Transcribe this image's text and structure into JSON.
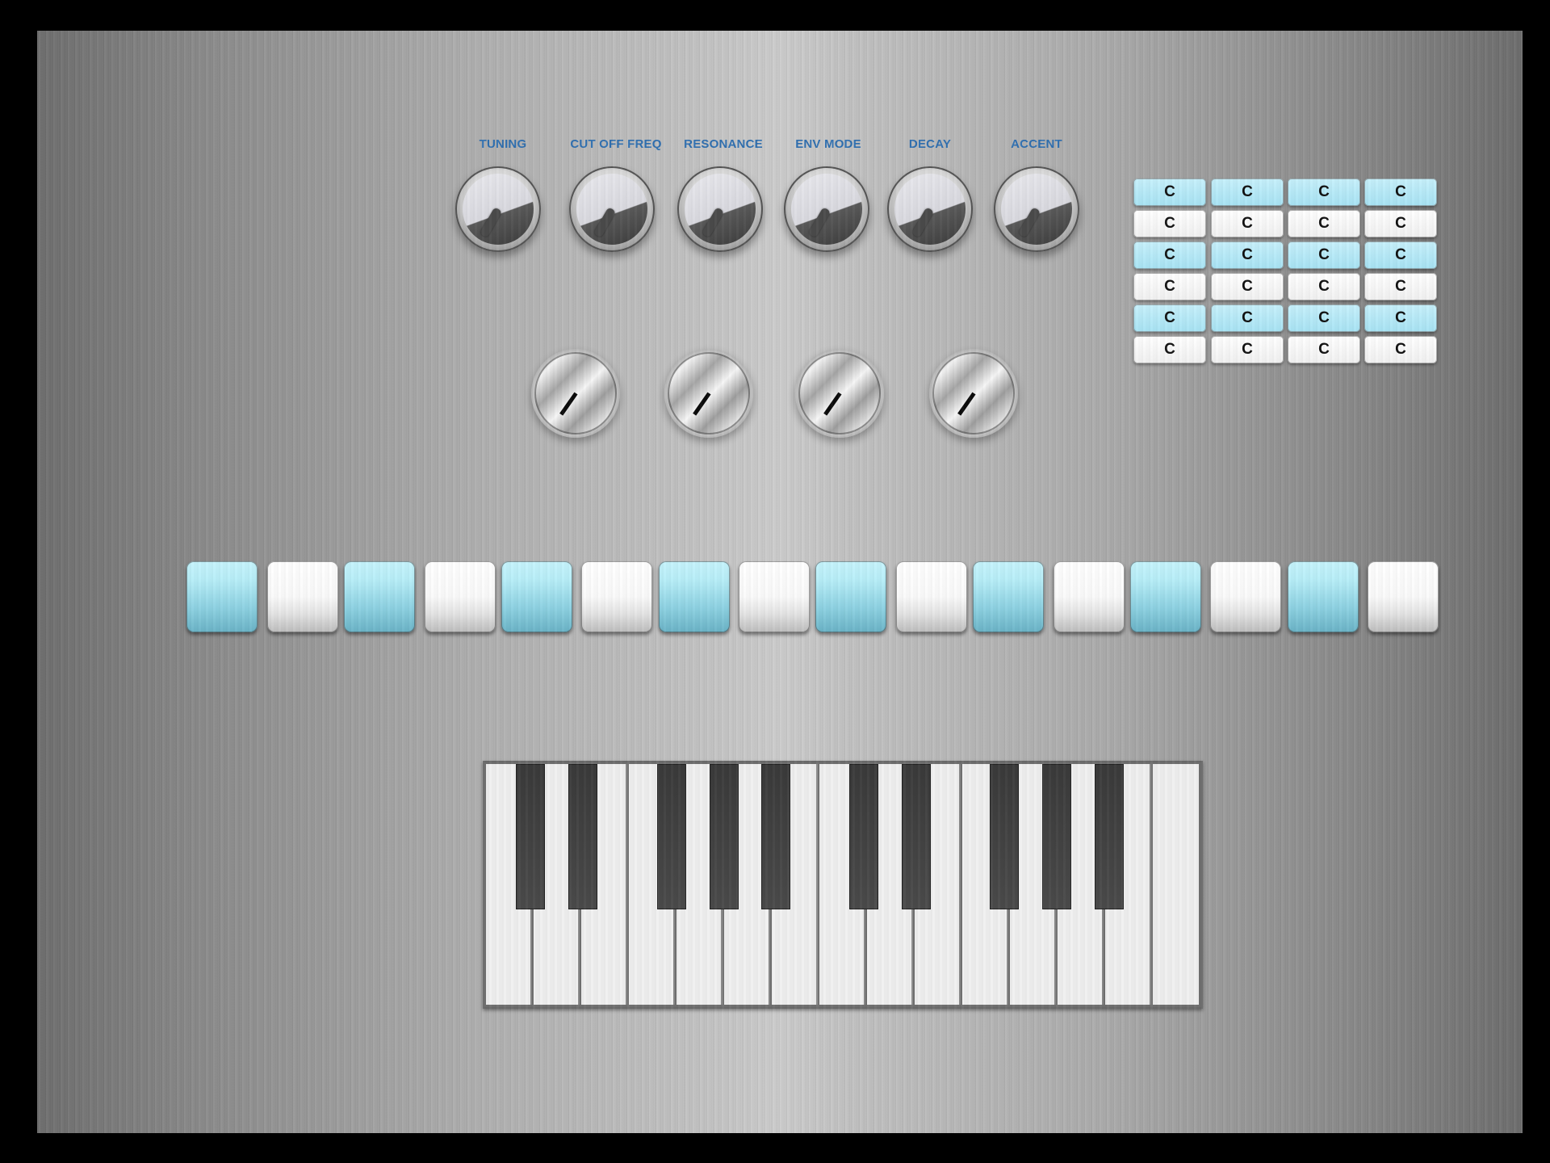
{
  "knobs": [
    {
      "label": "TUNING"
    },
    {
      "label": "CUT OFF FREQ"
    },
    {
      "label": "RESONANCE"
    },
    {
      "label": "ENV MODE"
    },
    {
      "label": "DECAY"
    },
    {
      "label": "ACCENT"
    }
  ],
  "note_grid": {
    "rows": [
      [
        "C",
        "C",
        "C",
        "C"
      ],
      [
        "C",
        "C",
        "C",
        "C"
      ],
      [
        "C",
        "C",
        "C",
        "C"
      ],
      [
        "C",
        "C",
        "C",
        "C"
      ],
      [
        "C",
        "C",
        "C",
        "C"
      ],
      [
        "C",
        "C",
        "C",
        "C"
      ]
    ]
  },
  "step_pads": {
    "count": 16
  },
  "keyboard": {
    "white_keys": 15,
    "black_keys": 10
  },
  "colors": {
    "label_blue": "#2f6fb0",
    "pad_blue": "#9ad9e8",
    "cell_blue": "#b4e9f7"
  }
}
